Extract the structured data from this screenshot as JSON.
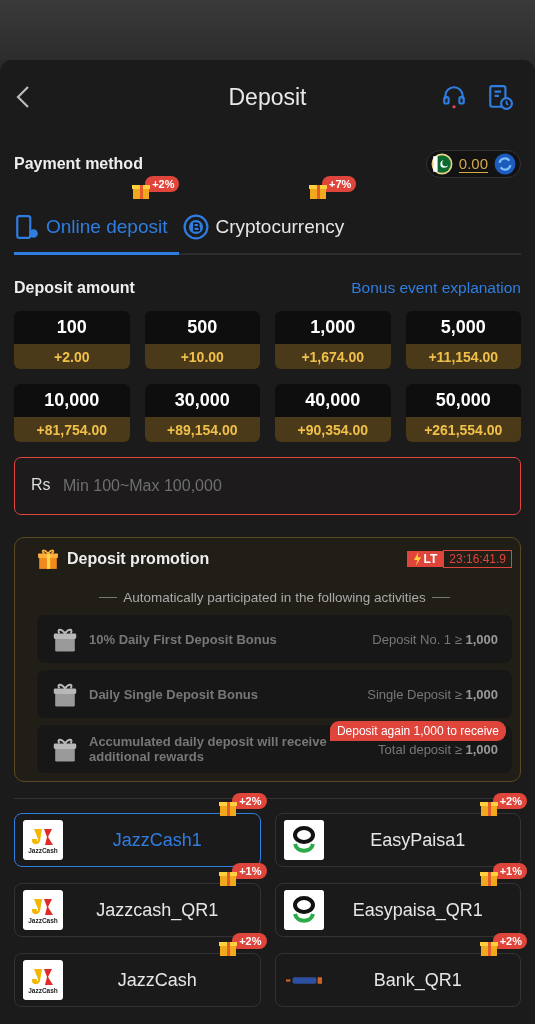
{
  "header": {
    "title": "Deposit"
  },
  "payment_method": {
    "label": "Payment method",
    "balance": "0.00"
  },
  "tabs": [
    {
      "label": "Online deposit",
      "badge": "+2%",
      "kind": "phone",
      "selected": true
    },
    {
      "label": "Cryptocurrency",
      "badge": "+7%",
      "kind": "crypto",
      "selected": false
    }
  ],
  "deposit_amount": {
    "label": "Deposit amount",
    "link": "Bonus event explanation"
  },
  "amounts": [
    {
      "value": "100",
      "bonus": "+2.00"
    },
    {
      "value": "500",
      "bonus": "+10.00"
    },
    {
      "value": "1,000",
      "bonus": "+1,674.00"
    },
    {
      "value": "5,000",
      "bonus": "+11,154.00"
    },
    {
      "value": "10,000",
      "bonus": "+81,754.00"
    },
    {
      "value": "30,000",
      "bonus": "+89,154.00"
    },
    {
      "value": "40,000",
      "bonus": "+90,354.00"
    },
    {
      "value": "50,000",
      "bonus": "+261,554.00"
    }
  ],
  "amount_field": {
    "prefix": "Rs",
    "placeholder": "Min 100~Max 100,000"
  },
  "promotion": {
    "title": "Deposit promotion",
    "timer_label": "LT",
    "timer": "23:16:41.9",
    "subtitle": "Automatically participated in the following activities",
    "activities": [
      {
        "name": "10% Daily First Deposit Bonus",
        "condition": "Deposit No. 1 ≥ **1,000**"
      },
      {
        "name": "Daily Single Deposit Bonus",
        "condition": "Single Deposit ≥ **1,000**"
      },
      {
        "name": "Accumulated daily deposit will receive additional rewards",
        "condition": "Total deposit ≥ **1,000**",
        "tip": "Deposit again 1,000 to receive"
      }
    ]
  },
  "methods": [
    {
      "name": "JazzCash1",
      "badge": "+2%",
      "kind": "jazz",
      "logo_text": "JazzCash",
      "selected": true
    },
    {
      "name": "EasyPaisa1",
      "badge": "+2%",
      "kind": "easy",
      "selected": false
    },
    {
      "name": "Jazzcash_QR1",
      "badge": "+1%",
      "kind": "jazz",
      "logo_text": "JazzCash",
      "selected": false
    },
    {
      "name": "Easypaisa_QR1",
      "badge": "+1%",
      "kind": "easy",
      "selected": false
    },
    {
      "name": "JazzCash",
      "badge": "+2%",
      "kind": "jazz",
      "logo_text": "JazzCash",
      "selected": false
    },
    {
      "name": "Bank_QR1",
      "badge": "+2%",
      "kind": "bank",
      "selected": false
    }
  ]
}
